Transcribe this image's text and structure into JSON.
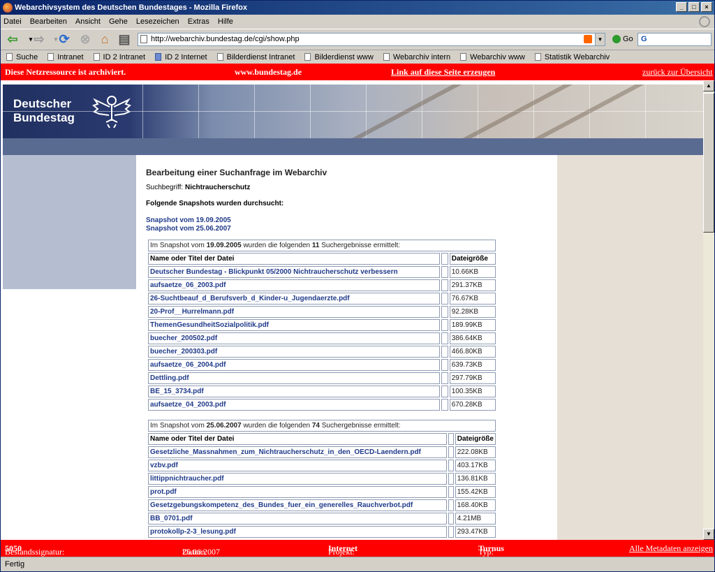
{
  "window": {
    "title": "Webarchivsystem des Deutschen Bundestages - Mozilla Firefox"
  },
  "menu": [
    "Datei",
    "Bearbeiten",
    "Ansicht",
    "Gehe",
    "Lesezeichen",
    "Extras",
    "Hilfe"
  ],
  "nav": {
    "url": "http://webarchiv.bundestag.de/cgi/show.php",
    "go_label": "Go",
    "search_value": "G"
  },
  "bookmarks": [
    "Suche",
    "Intranet",
    "ID 2 Intranet",
    "ID 2 Internet",
    "Bilderdienst Intranet",
    "Bilderdienst www",
    "Webarchiv intern",
    "Webarchiv www",
    "Statistik Webarchiv"
  ],
  "archive_bar": {
    "notice": "Diese Netzressource ist archiviert.",
    "site": "www.bundestag.de",
    "link_label": "Link auf diese Seite erzeugen",
    "back_label": "zurück zur Übersicht"
  },
  "banner": {
    "line1": "Deutscher",
    "line2": "Bundestag"
  },
  "page": {
    "heading": "Bearbeitung einer Suchanfrage im Webarchiv",
    "term_label": "Suchbegriff:",
    "term_value": "Nichtraucherschutz",
    "searched_heading": "Folgende Snapshots wurden durchsucht:",
    "snapshots": [
      "Snapshot vom 19.09.2005",
      "Snapshot vom 25.06.2007"
    ]
  },
  "table1": {
    "cap_pre": "Im Snapshot vom",
    "cap_date": "19.09.2005",
    "cap_mid": "wurden die folgenden",
    "cap_count": "11",
    "cap_post": "Suchergebnisse ermittelt:",
    "col_name": "Name oder Titel der Datei",
    "col_size": "Dateigröße",
    "rows": [
      {
        "name": "Deutscher Bundestag - Blickpunkt 05/2000 Nichtraucherschutz verbessern",
        "size": "10.66KB"
      },
      {
        "name": "aufsaetze_06_2003.pdf",
        "size": "291.37KB"
      },
      {
        "name": "26-Suchtbeauf_d_Berufsverb_d_Kinder-u_Jugendaerzte.pdf",
        "size": "76.67KB"
      },
      {
        "name": "20-Prof__Hurrelmann.pdf",
        "size": "92.28KB"
      },
      {
        "name": "ThemenGesundheitSozialpolitik.pdf",
        "size": "189.99KB"
      },
      {
        "name": "buecher_200502.pdf",
        "size": "386.64KB"
      },
      {
        "name": "buecher_200303.pdf",
        "size": "466.80KB"
      },
      {
        "name": "aufsaetze_06_2004.pdf",
        "size": "639.73KB"
      },
      {
        "name": "Dettling.pdf",
        "size": "297.79KB"
      },
      {
        "name": "BE_15_3734.pdf",
        "size": "100.35KB"
      },
      {
        "name": "aufsaetze_04_2003.pdf",
        "size": "670.28KB"
      }
    ]
  },
  "table2": {
    "cap_pre": "Im Snapshot vom",
    "cap_date": "25.06.2007",
    "cap_mid": "wurden die folgenden",
    "cap_count": "74",
    "cap_post": "Suchergebnisse ermittelt:",
    "col_name": "Name oder Titel der Datei",
    "col_size": "Dateigröße",
    "rows": [
      {
        "name": "Gesetzliche_Massnahmen_zum_Nichtraucherschutz_in_den_OECD-Laendern.pdf",
        "size": "222.08KB"
      },
      {
        "name": "vzbv.pdf",
        "size": "403.17KB"
      },
      {
        "name": "littippnichtraucher.pdf",
        "size": "136.81KB"
      },
      {
        "name": "prot.pdf",
        "size": "155.42KB"
      },
      {
        "name": "Gesetzgebungskompetenz_des_Bundes_fuer_ein_generelles_Rauchverbot.pdf",
        "size": "168.40KB"
      },
      {
        "name": "BB_0701.pdf",
        "size": "4.21MB"
      },
      {
        "name": "protokollp-2-3_lesung.pdf",
        "size": "293.47KB"
      }
    ]
  },
  "meta_bar": {
    "sig_label": "Bestandssignatur:",
    "sig_value": "5050",
    "date_label": "Datum:",
    "date_value": "25.06.2007",
    "proj_label": "Projekt:",
    "proj_value": "Internet",
    "typ_label": "Typ:",
    "typ_value": "Turnus",
    "all_meta_label": "Alle Metadaten anzeigen"
  },
  "status": "Fertig",
  "colors": {
    "archive_red": "#ff0000",
    "link_blue": "#1f3a8a",
    "bar_blue": "#5a6b92"
  }
}
